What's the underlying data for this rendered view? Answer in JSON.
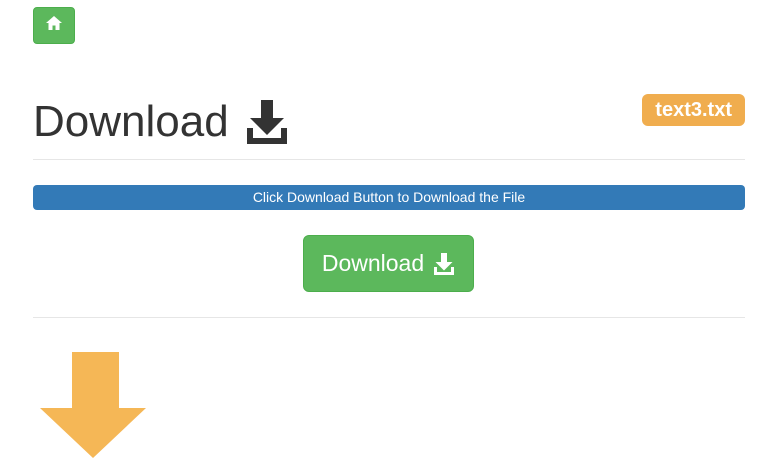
{
  "nav": {
    "home_icon": "home-icon"
  },
  "header": {
    "title": "Download",
    "title_icon": "download-icon",
    "file_name": "text3.txt"
  },
  "progress": {
    "label": "Click Download Button to Download the File",
    "fill_percent": 100,
    "color": "#337ab7"
  },
  "download_button": {
    "label": "Download",
    "icon": "download-icon",
    "color": "#5cb85c"
  },
  "indicator": {
    "icon": "arrow-down-icon",
    "color": "#f5b756"
  },
  "colors": {
    "badge": "#f0ad4e",
    "home_button": "#5cb85c"
  }
}
